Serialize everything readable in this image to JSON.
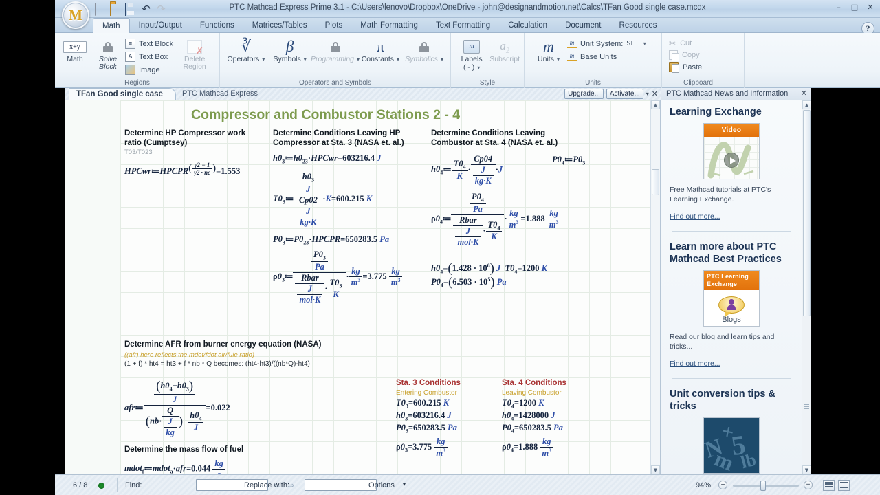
{
  "window": {
    "title": "PTC Mathcad Express Prime 3.1 - C:\\Users\\lenovo\\Dropbox\\OneDrive - john@designandmotion.net\\Calcs\\TFan Good single case.mcdx",
    "minimize": "–",
    "maximize": "□",
    "close": "✕",
    "logo_letter": "M"
  },
  "quick_access": [
    {
      "name": "new-document-icon",
      "glyph": ""
    },
    {
      "name": "open-folder-icon",
      "glyph": ""
    },
    {
      "name": "save-icon",
      "glyph": ""
    },
    {
      "name": "undo-icon",
      "glyph": "↶"
    },
    {
      "name": "redo-icon",
      "glyph": "↷"
    }
  ],
  "ribbon_tabs": [
    {
      "label": "Math",
      "active": true
    },
    {
      "label": "Input/Output",
      "active": false
    },
    {
      "label": "Functions",
      "active": false
    },
    {
      "label": "Matrices/Tables",
      "active": false
    },
    {
      "label": "Plots",
      "active": false
    },
    {
      "label": "Math Formatting",
      "active": false
    },
    {
      "label": "Text Formatting",
      "active": false
    },
    {
      "label": "Calculation",
      "active": false
    },
    {
      "label": "Document",
      "active": false
    },
    {
      "label": "Resources",
      "active": false
    }
  ],
  "help_button": "?",
  "ribbon": {
    "groups": [
      {
        "name": "regions",
        "label": "Regions",
        "big_buttons": [
          {
            "label": "Math",
            "icon": "math-xy-icon",
            "dim": false,
            "italic": false
          },
          {
            "label": "Solve\nBlock",
            "label_l1": "Solve",
            "label_l2": "Block",
            "icon": "lock-icon",
            "dim": false,
            "italic": true
          }
        ],
        "small_buttons": [
          {
            "label": "Text Block",
            "icon": "text-block-icon"
          },
          {
            "label": "Text Box",
            "icon": "text-box-icon"
          },
          {
            "label": "Image",
            "icon": "image-icon"
          }
        ],
        "delete_region": {
          "label_l1": "Delete",
          "label_l2": "Region",
          "icon": "delete-region-icon",
          "dim": true
        }
      },
      {
        "name": "operators-and-symbols",
        "label": "Operators and Symbols",
        "buttons": [
          {
            "label": "Operators",
            "icon": "radical-icon",
            "dim": false,
            "italic": false,
            "caret": true
          },
          {
            "label": "Symbols",
            "icon": "beta-icon",
            "dim": false,
            "italic": false,
            "caret": true
          },
          {
            "label": "Programming",
            "icon": "lock-icon",
            "dim": true,
            "italic": true,
            "caret": true
          },
          {
            "label": "Constants",
            "icon": "pi-icon",
            "dim": false,
            "italic": false,
            "caret": true
          },
          {
            "label": "Symbolics",
            "icon": "lock-icon",
            "dim": true,
            "italic": true,
            "caret": true
          }
        ]
      },
      {
        "name": "style",
        "label": "Style",
        "buttons": [
          {
            "label": "Labels",
            "sublabel": "( - )",
            "icon": "labels-icon",
            "dim": false,
            "caret": true
          },
          {
            "label": "Subscript",
            "icon": "subscript-icon",
            "dim": true,
            "caret": false
          }
        ]
      },
      {
        "name": "units",
        "label": "Units",
        "buttons": [
          {
            "label": "Units",
            "icon": "units-m-icon",
            "dim": false,
            "caret": true
          }
        ],
        "rows": [
          {
            "label": "Unit System:",
            "value": "SI",
            "icon": "unit-system-icon",
            "caret": true
          },
          {
            "label": "Base Units",
            "icon": "base-units-icon",
            "caret": false
          }
        ]
      },
      {
        "name": "clipboard",
        "label": "Clipboard",
        "rows": [
          {
            "label": "Cut",
            "icon": "scissors-icon",
            "enabled": false
          },
          {
            "label": "Copy",
            "icon": "copy-icon",
            "enabled": false
          },
          {
            "label": "Paste",
            "icon": "paste-icon",
            "enabled": true
          }
        ]
      }
    ]
  },
  "doc_tabs": {
    "active_tab": "TFan Good single case",
    "secondary_tab": "PTC Mathcad Express",
    "upgrade_button": "Upgrade...",
    "activate_button": "Activate...",
    "caret": "▾",
    "close": "✕"
  },
  "worksheet": {
    "title": "Compressor and Combustor Stations 2 - 4",
    "sections": {
      "hpc_work_ratio": {
        "heading_l1": "Determine HP Compressor work",
        "heading_l2": "ratio (Cumptsey)",
        "subnote": "T03/T023",
        "equation": "HPCwr := HPCPR^((γ2-1)/(γ2·nc)) = 1.553",
        "var": "HPCwr",
        "base": "HPCPR",
        "exp_num": "γ2 − 1",
        "exp_den": "γ2 · nc",
        "result": "1.553"
      },
      "sta3": {
        "heading_l1": "Determine Conditions Leaving HP",
        "heading_l2": "Compressor at Sta. 3 (NASA et. al.)",
        "eq1": {
          "lhs": "h0₃",
          "rhs": "h0₂₃ · HPCwr",
          "result": "603216.4",
          "unit": "J"
        },
        "eq2": {
          "lhs": "T0₃",
          "num": "h0₃ / J",
          "den": "Cp02 / (J/(kg·K))",
          "mult": "K",
          "result": "600.215",
          "unit": "K"
        },
        "eq3": {
          "lhs": "P0₃",
          "rhs": "P0₂₃ · HPCPR",
          "result": "650283.5",
          "unit": "Pa"
        },
        "eq4": {
          "lhs": "ρ0₃",
          "num": "P0₃ / Pa",
          "den": "(Rbar / (J/(mol·K))) · (T0₃ / K)",
          "mult": "kg/m³",
          "result": "3.775",
          "unit": "kg/m³"
        }
      },
      "sta4": {
        "heading_l1": "Determine Conditions Leaving",
        "heading_l2": "Combustor at Sta. 4 (NASA et. al.)",
        "eq1": {
          "lhs": "h0₄",
          "rhs": "(T0₄/K) · (Cp04/(J/(kg·K))) · J"
        },
        "eq2": {
          "lhs": "P0₄",
          "rhs": "P0₃"
        },
        "eq3": {
          "lhs": "ρ0₄",
          "num": "P0₄ / Pa",
          "den": "(Rbar / (J/(mol·K))) · (T0₄ / K)",
          "mult": "kg/m³",
          "result": "1.888",
          "unit": "kg/m³"
        },
        "out1": {
          "lhs": "h0₄",
          "mant": "1.428",
          "exp": "6",
          "unit": "J"
        },
        "out2": {
          "lhs": "T0₄",
          "result": "1200",
          "unit": "K"
        },
        "out3": {
          "lhs": "P0₄",
          "mant": "6.503",
          "exp": "5",
          "unit": "Pa"
        }
      },
      "afr": {
        "heading": "Determine AFR from burner energy equation (NASA)",
        "note_gold": "((afr) here reflects the mdot/fdot air/fule ratio)",
        "note_plain": "(1 + f) * ht4 = ht3 + f * nb * Q  becomes: (ht4-ht3)/((nb*Q)-ht4)",
        "equation": {
          "lhs": "afr",
          "num": "(h0₄ − h0₃) / J",
          "den": "(nb · Q/(J/kg)) − h0₄/J",
          "result": "0.022"
        }
      },
      "mass_flow_fuel": {
        "heading": "Determine the mass flow of fuel",
        "equation": {
          "lhs": "mdot_f",
          "rhs": "mdot_a · afr",
          "result": "0.044",
          "unit": "kg/s"
        }
      }
    },
    "sta3_conditions": {
      "title": "Sta. 3 Conditions",
      "subtitle": "Entering Combustor",
      "rows": [
        {
          "lhs": "T0₃",
          "value": "600.215",
          "unit": "K"
        },
        {
          "lhs": "h0₃",
          "value": "603216.4",
          "unit": "J"
        },
        {
          "lhs": "P0₃",
          "value": "650283.5",
          "unit": "Pa"
        },
        {
          "lhs": "ρ0₃",
          "value": "3.775",
          "unit": "kg/m³"
        }
      ]
    },
    "sta4_conditions": {
      "title": "Sta. 4 Conditions",
      "subtitle": "Leaving Combustor",
      "rows": [
        {
          "lhs": "T0₄",
          "value": "1200",
          "unit": "K"
        },
        {
          "lhs": "h0₄",
          "value": "1428000",
          "unit": "J"
        },
        {
          "lhs": "P0₄",
          "value": "650283.5",
          "unit": "Pa"
        },
        {
          "lhs": "ρ0₄",
          "value": "1.888",
          "unit": "kg/m³"
        }
      ]
    }
  },
  "news_panel": {
    "header": "PTC Mathcad News and Information",
    "close": "✕",
    "items": [
      {
        "title": "Learning Exchange",
        "thumb": "video-thumbnail",
        "thumb_badge": "Video",
        "text": "Free Mathcad tutorials at PTC's Learning Exchange.",
        "link": "Find out more..."
      },
      {
        "title": "Learn more about PTC Mathcad Best Practices",
        "thumb": "blogs-thumbnail",
        "thumb_badge_l1": "PTC Learning",
        "thumb_badge_l2": "Exchange",
        "thumb_caption": "Blogs",
        "text": "Read our blog and learn tips and tricks...",
        "link": "Find out more..."
      },
      {
        "title": "Unit conversion tips & tricks",
        "thumb": "units-thumbnail",
        "text": "",
        "link": ""
      }
    ]
  },
  "status_bar": {
    "page_indicator": "6 / 8",
    "calc_status": "calculation-ok",
    "find_label": "Find:",
    "find_value": "",
    "replace_label": "Replace with:",
    "replace_value": "",
    "options_label": "Options",
    "options_caret": "▾",
    "prev_arrow": "⇐",
    "next_arrow": "⇒",
    "replace_arrow": "⇒",
    "zoom_level": "94%",
    "zoom_minus": "−",
    "zoom_plus": "+"
  },
  "colors": {
    "title_green": "#7d9b4e",
    "math_blue": "#14233d",
    "unit_blue": "#2f4fa8",
    "cond_red": "#a83232",
    "note_gold": "#c8a02a",
    "accent_orange": "#e2720c",
    "panel_navy": "#1c3354"
  }
}
